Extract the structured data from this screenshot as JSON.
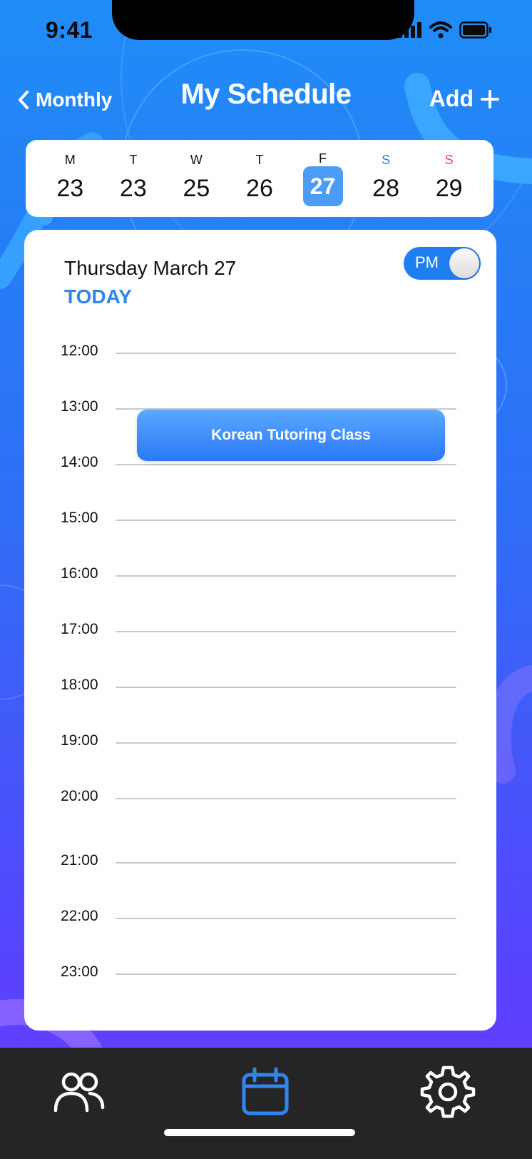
{
  "status_bar": {
    "time": "9:41",
    "icons": [
      "signal-icon",
      "wifi-icon",
      "battery-icon"
    ]
  },
  "header": {
    "back_label": "Monthly",
    "title": "My Schedule",
    "add_label": "Add"
  },
  "week": {
    "days": [
      {
        "letter": "M",
        "number": "23"
      },
      {
        "letter": "T",
        "number": "23"
      },
      {
        "letter": "W",
        "number": "25"
      },
      {
        "letter": "T",
        "number": "26"
      },
      {
        "letter": "F",
        "number": "27"
      },
      {
        "letter": "S",
        "number": "28"
      },
      {
        "letter": "S",
        "number": "29"
      }
    ],
    "selected_index": 4
  },
  "schedule": {
    "date_label": "Thursday March 27",
    "today_label": "TODAY",
    "ampm": "PM",
    "hours": [
      "12:00",
      "13:00",
      "14:00",
      "15:00",
      "16:00",
      "17:00",
      "18:00",
      "19:00",
      "20:00",
      "21:00",
      "22:00",
      "23:00"
    ],
    "event": {
      "title": "Korean Tutoring Class"
    }
  },
  "tabs": [
    {
      "name": "people-icon"
    },
    {
      "name": "calendar-icon"
    },
    {
      "name": "settings-icon"
    }
  ],
  "colors": {
    "accent": "#2f86f0",
    "saturday": "#2a7ff0",
    "sunday": "#f04a3a",
    "tabbar": "#252525",
    "active_tab": "#2f86f0"
  }
}
